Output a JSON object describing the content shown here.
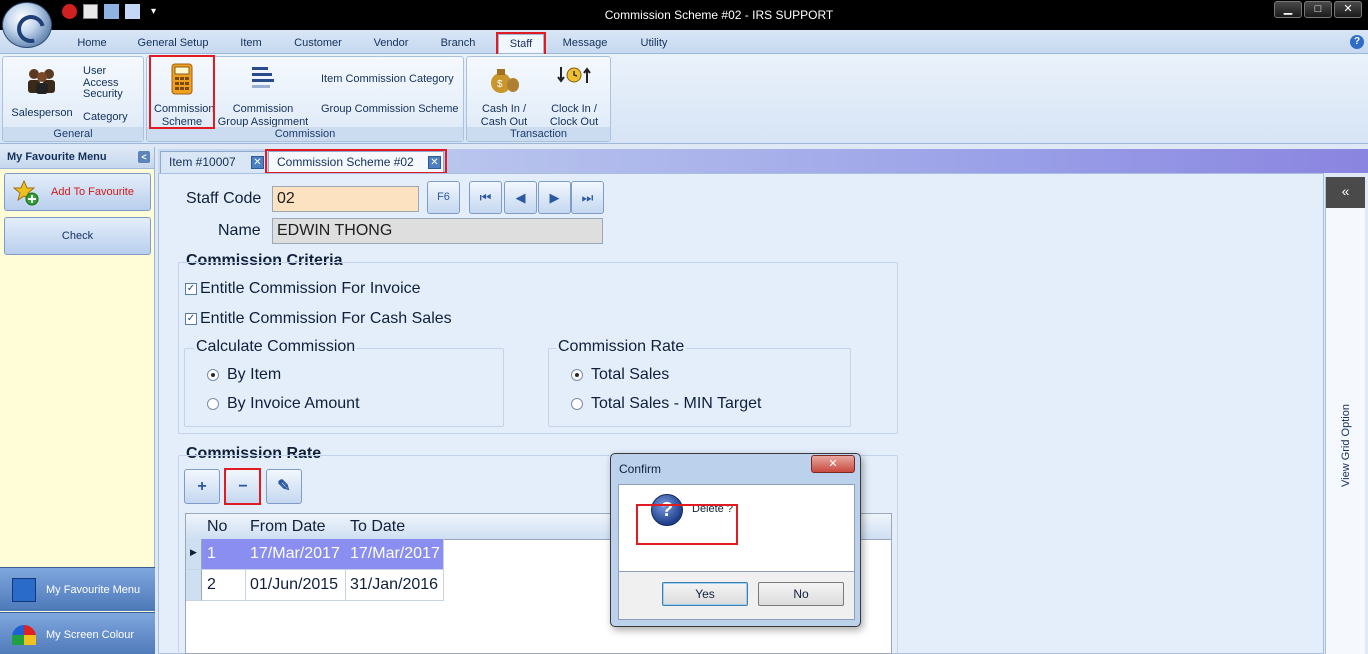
{
  "window": {
    "title": "Commission Scheme #02 - IRS SUPPORT",
    "controls": {
      "minimize": "▁",
      "maximize": "□",
      "close": "✕"
    }
  },
  "ribbon": {
    "tabs": [
      {
        "label": "Home"
      },
      {
        "label": "General Setup"
      },
      {
        "label": "Item"
      },
      {
        "label": "Customer"
      },
      {
        "label": "Vendor"
      },
      {
        "label": "Branch"
      },
      {
        "label": "Staff"
      },
      {
        "label": "Message"
      },
      {
        "label": "Utility"
      }
    ],
    "active_tab": "Staff",
    "groups": {
      "general": {
        "label": "General",
        "salesperson": "Salesperson",
        "user_access": "User Access",
        "security": "Security",
        "category": "Category"
      },
      "commission": {
        "label": "Commission",
        "commission_scheme": "Commission Scheme",
        "group_assignment": "Commission Group Assignment",
        "item_category": "Item Commission Category",
        "group_scheme": "Group Commission Scheme"
      },
      "transaction": {
        "label": "Transaction",
        "cash_in_out": "Cash In / Cash Out",
        "clock_in_out": "Clock In / Clock Out"
      }
    },
    "help": "?"
  },
  "left_panel": {
    "header": "My Favourite Menu",
    "collapse": "<",
    "add_to_favourite": "Add To Favourite",
    "check": "Check",
    "nav_favourite": "My Favourite Menu",
    "nav_screen_colour": "My Screen Colour"
  },
  "doc_tabs": [
    {
      "label": "Item #10007"
    },
    {
      "label": "Commission Scheme #02"
    }
  ],
  "form": {
    "staff_code_label": "Staff Code",
    "staff_code_value": "02",
    "f6_button": "F6",
    "name_label": "Name",
    "name_value": "EDWIN THONG",
    "criteria_title": "Commission Criteria",
    "entitle_invoice": "Entitle Commission For Invoice",
    "entitle_cash_sales": "Entitle Commission For Cash Sales",
    "calc_title": "Calculate Commission",
    "by_item": "By Item",
    "by_invoice_amount": "By Invoice Amount",
    "rate_title": "Commission Rate",
    "total_sales": "Total Sales",
    "total_sales_min": "Total Sales - MIN Target",
    "rate_section_title": "Commission Rate"
  },
  "grid": {
    "columns": [
      "No",
      "From Date",
      "To Date"
    ],
    "rows": [
      {
        "no": "1",
        "from": "17/Mar/2017",
        "to": "17/Mar/2017"
      },
      {
        "no": "2",
        "from": "01/Jun/2015",
        "to": "31/Jan/2016"
      }
    ]
  },
  "right_grip": {
    "collapse": "«",
    "label": "View Grid Option"
  },
  "dialog": {
    "title": "Confirm",
    "message": "Delete ?",
    "yes": "Yes",
    "no": "No",
    "close": "✕"
  }
}
